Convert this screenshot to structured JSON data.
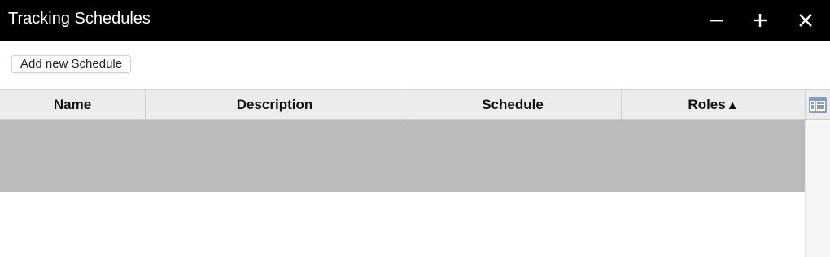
{
  "window": {
    "title": "Tracking Schedules",
    "controls": {
      "minimize_icon": "minus-icon",
      "maximize_icon": "plus-icon",
      "close_icon": "close-icon"
    }
  },
  "toolbar": {
    "add_label": "Add new Schedule"
  },
  "grid": {
    "columns": [
      {
        "label": "Name"
      },
      {
        "label": "Description"
      },
      {
        "label": "Schedule"
      },
      {
        "label": "Roles",
        "sort": "ascending",
        "sort_indicator": "▲"
      }
    ],
    "column_chooser_icon": "column-chooser-icon",
    "rows": [
      {
        "name": "",
        "description": "",
        "schedule": "",
        "roles": "",
        "selected": true
      }
    ],
    "colors": {
      "header_bg": "#ececec",
      "selected_row": "#bbbabd",
      "titlebar": "#000000"
    }
  }
}
